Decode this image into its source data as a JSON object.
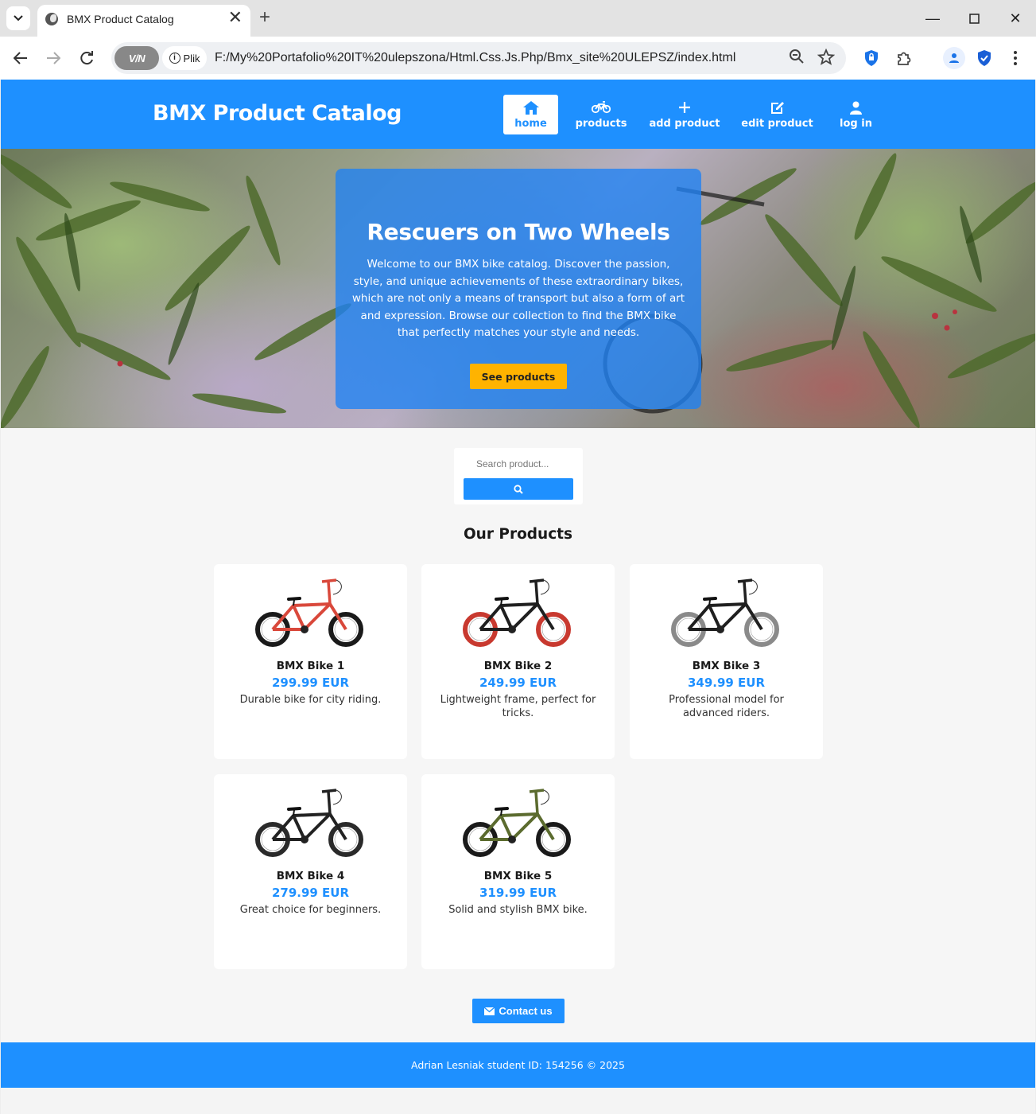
{
  "browser": {
    "tab_title": "BMX Product Catalog",
    "omnibox_badge": "V/N",
    "scheme_label": "Plik",
    "url": "F:/My%20Portafolio%20IT%20ulepszona/Html.Css.Js.Php/Bmx_site%20ULEPSZ/index.html"
  },
  "site": {
    "brand": "BMX Product Catalog",
    "nav": [
      {
        "label": "home",
        "icon": "home-icon",
        "active": true
      },
      {
        "label": "products",
        "icon": "bicycle-icon"
      },
      {
        "label": "add product",
        "icon": "plus-icon"
      },
      {
        "label": "edit product",
        "icon": "edit-icon"
      },
      {
        "label": "log in",
        "icon": "user-icon"
      }
    ]
  },
  "hero": {
    "title": "Rescuers on Two Wheels",
    "text": "Welcome to our BMX bike catalog. Discover the passion, style, and unique achievements of these extraordinary bikes, which are not only a means of transport but also a form of art and expression. Browse our collection to find the BMX bike that perfectly matches your style and needs.",
    "button": "See products"
  },
  "search": {
    "placeholder": "Search product..."
  },
  "products_title": "Our Products",
  "products": [
    {
      "name": "BMX Bike 1",
      "price": "299.99 EUR",
      "description": "Durable bike for city riding.",
      "frame_color": "#d9483b",
      "tire_color": "#1a1a1a"
    },
    {
      "name": "BMX Bike 2",
      "price": "249.99 EUR",
      "description": "Lightweight frame, perfect for tricks.",
      "frame_color": "#1f1f1f",
      "tire_color": "#c8392f"
    },
    {
      "name": "BMX Bike 3",
      "price": "349.99 EUR",
      "description": "Professional model for advanced riders.",
      "frame_color": "#1f1f1f",
      "tire_color": "#8a8a8a"
    },
    {
      "name": "BMX Bike 4",
      "price": "279.99 EUR",
      "description": "Great choice for beginners.",
      "frame_color": "#222222",
      "tire_color": "#2a2a2a"
    },
    {
      "name": "BMX Bike 5",
      "price": "319.99 EUR",
      "description": "Solid and stylish BMX bike.",
      "frame_color": "#5b6b2e",
      "tire_color": "#1a1a1a"
    }
  ],
  "contact_button": "Contact us",
  "footer": "Adrian Lesniak student ID: 154256 © 2025",
  "colors": {
    "brand_blue": "#1e90ff",
    "cta_yellow": "#ffb300"
  }
}
